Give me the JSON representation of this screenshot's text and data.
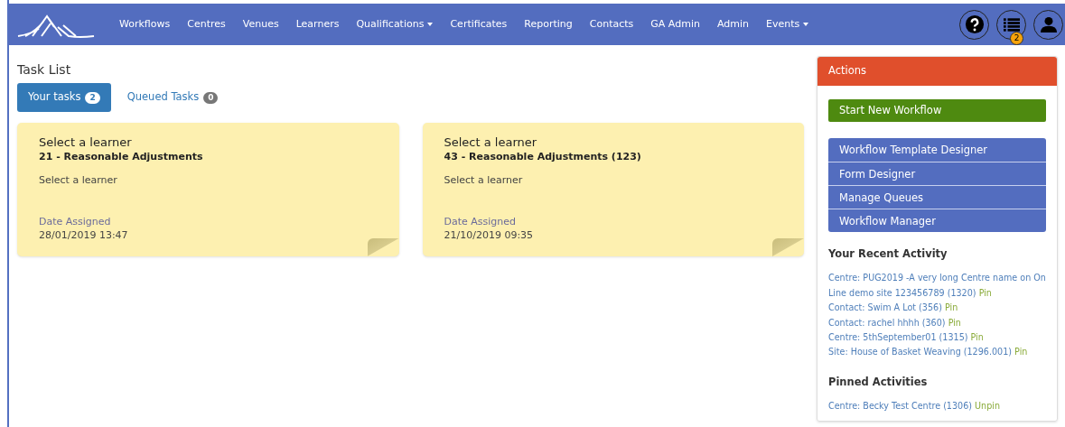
{
  "nav": {
    "items": [
      {
        "label": "Workflows",
        "has_dropdown": false
      },
      {
        "label": "Centres",
        "has_dropdown": false
      },
      {
        "label": "Venues",
        "has_dropdown": false
      },
      {
        "label": "Learners",
        "has_dropdown": false
      },
      {
        "label": "Qualifications",
        "has_dropdown": true
      },
      {
        "label": "Certificates",
        "has_dropdown": false
      },
      {
        "label": "Reporting",
        "has_dropdown": false
      },
      {
        "label": "Contacts",
        "has_dropdown": false
      },
      {
        "label": "GA Admin",
        "has_dropdown": false
      },
      {
        "label": "Admin",
        "has_dropdown": false
      },
      {
        "label": "Events",
        "has_dropdown": true
      }
    ],
    "icons": [
      {
        "kind": "help"
      },
      {
        "kind": "tasks",
        "badge": "2"
      },
      {
        "kind": "user"
      }
    ]
  },
  "page_title": "Task List",
  "tabs": [
    {
      "label": "Your tasks",
      "count": "2",
      "selected": true
    },
    {
      "label": "Queued Tasks",
      "count": "0",
      "selected": false
    }
  ],
  "tasks": [
    {
      "title": "Select a learner",
      "subtitle": "21 - Reasonable Adjustments",
      "description": "Select a learner",
      "date_label": "Date Assigned",
      "date": "28/01/2019 13:47"
    },
    {
      "title": "Select a learner",
      "subtitle": "43 - Reasonable Adjustments (123)",
      "description": "Select a learner",
      "date_label": "Date Assigned",
      "date": "21/10/2019 09:35"
    }
  ],
  "actions": {
    "title": "Actions",
    "primary_button": "Start New Workflow",
    "links": [
      "Workflow Template Designer",
      "Form Designer",
      "Manage Queues",
      "Workflow Manager"
    ],
    "recent_title": "Your Recent Activity",
    "recent": [
      {
        "text": "Centre: PUG2019 -A very long Centre name on On Line demo site 123456789 (1320)",
        "action": "Pin"
      },
      {
        "text": "Contact: Swim A Lot (356)",
        "action": "Pin"
      },
      {
        "text": "Contact: rachel hhhh (360)",
        "action": "Pin"
      },
      {
        "text": "Centre: 5thSeptember01 (1315)",
        "action": "Pin"
      },
      {
        "text": "Site: House of Basket Weaving (1296.001)",
        "action": "Pin"
      }
    ],
    "pinned_title": "Pinned Activities",
    "pinned": [
      {
        "text": "Centre: Becky Test Centre (1306)",
        "action": "Unpin"
      }
    ]
  }
}
